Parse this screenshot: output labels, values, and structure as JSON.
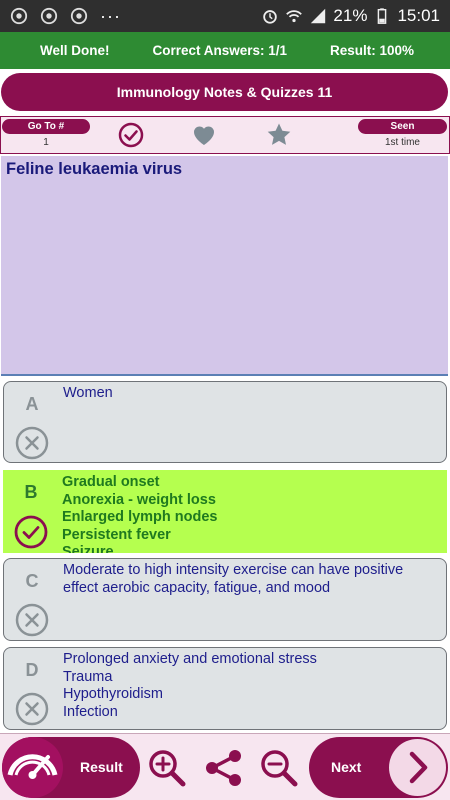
{
  "status_bar": {
    "battery": "21%",
    "time": "15:01",
    "more": "···",
    "icons": [
      "chrome-icon",
      "chrome-icon",
      "chrome-icon",
      "more-icon",
      "alarm-icon",
      "wifi-icon",
      "signal-icon",
      "battery-icon"
    ]
  },
  "score_bar": {
    "message": "Well Done!",
    "correct": "Correct Answers: 1/1",
    "result": "Result: 100%"
  },
  "title": "Immunology Notes & Quizzes 11",
  "tool_row": {
    "goto_label": "Go To #",
    "goto_value": "1",
    "seen_label": "Seen",
    "seen_value": "1st time",
    "icons": [
      "check-circle-icon",
      "heart-icon",
      "star-icon"
    ]
  },
  "question": {
    "text": "Feline leukaemia virus"
  },
  "answers": [
    {
      "letter": "A",
      "lines": [
        "Women"
      ],
      "state": "wrong"
    },
    {
      "letter": "B",
      "lines": [
        "Gradual onset",
        "Anorexia - weight loss",
        "Enlarged lymph nodes",
        "Persistent fever",
        "Seizure"
      ],
      "state": "correct"
    },
    {
      "letter": "C",
      "lines": [
        "Moderate to high intensity exercise can have positive effect aerobic capacity, fatigue, and mood"
      ],
      "state": "wrong"
    },
    {
      "letter": "D",
      "lines": [
        "Prolonged anxiety and emotional stress",
        "Trauma",
        "Hypothyroidism",
        "Infection"
      ],
      "state": "wrong"
    }
  ],
  "bottom_bar": {
    "result_label": "Result",
    "next_label": "Next",
    "icons": [
      "gauge-icon",
      "zoom-in-icon",
      "share-icon",
      "zoom-out-icon",
      "chevron-right-icon"
    ]
  },
  "colors": {
    "brand": "#8b0f4f",
    "score_green": "#2e8b33",
    "correct_bg": "#b5ff4f",
    "question_bg": "#d3c6e9",
    "answer_bg": "#dfe3e5"
  }
}
